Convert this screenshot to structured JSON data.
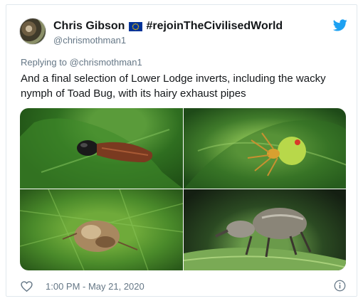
{
  "tweet": {
    "display_name": "Chris Gibson",
    "flag_icon": "eu-flag-icon",
    "hashtag": "#rejoinTheCivilisedWorld",
    "handle": "@chrismothman1",
    "replying_prefix": "Replying to",
    "replying_to": "@chrismothman1",
    "text": "And a final selection of Lower Lodge inverts, including the wacky nymph of Toad Bug, with its hairy exhaust pipes",
    "timestamp": "1:00 PM - May 21, 2020"
  },
  "colors": {
    "brand_blue": "#1da1f2",
    "secondary_text": "#657786",
    "eu_blue": "#003399",
    "eu_gold": "#ffcc00"
  },
  "icons": {
    "logo": "twitter-bird-icon",
    "like": "heart-icon",
    "info": "info-icon"
  }
}
